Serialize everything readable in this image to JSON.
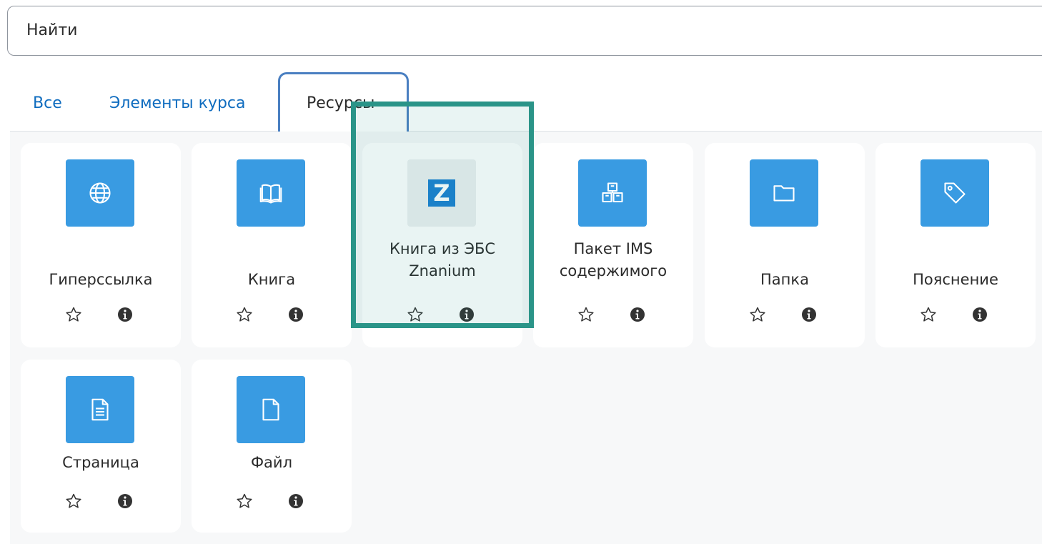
{
  "search": {
    "placeholder": "Найти",
    "value": ""
  },
  "tabs": [
    {
      "label": "Все",
      "active": false
    },
    {
      "label": "Элементы курса",
      "active": false
    },
    {
      "label": "Ресурсы",
      "active": true
    }
  ],
  "colors": {
    "accent": "#0f6cbf",
    "icon_tile": "#399be2",
    "highlight": "#2a9488",
    "active_tab_outline": "#4a7fc1"
  },
  "resources": [
    {
      "name": "Гиперссылка",
      "icon": "globe-icon"
    },
    {
      "name": "Книга",
      "icon": "book-icon"
    },
    {
      "name_line1": "Книга из ЭБС",
      "name_line2": "Znanium",
      "icon": "znanium-icon",
      "icon_letter": "Z"
    },
    {
      "name_line1": "Пакет IMS",
      "name_line2": "содержимого",
      "icon": "package-icon"
    },
    {
      "name": "Папка",
      "icon": "folder-icon"
    },
    {
      "name": "Пояснение",
      "icon": "tag-icon"
    },
    {
      "name": "Страница",
      "icon": "page-icon"
    },
    {
      "name": "Файл",
      "icon": "file-icon"
    }
  ],
  "actions": {
    "favourite_icon": "star-icon",
    "info_icon": "info-icon"
  }
}
